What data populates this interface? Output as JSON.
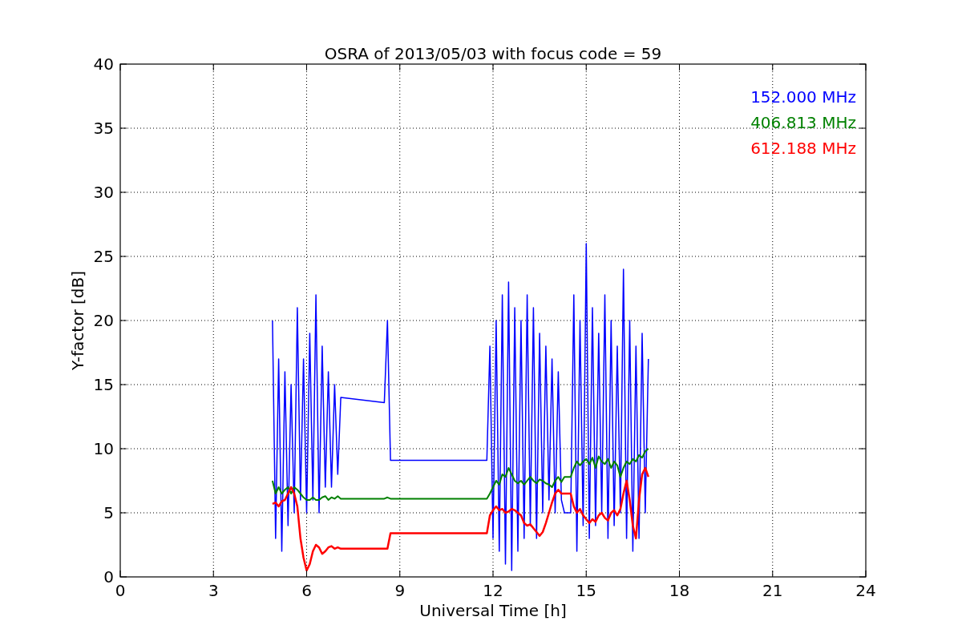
{
  "chart_data": {
    "type": "line",
    "title": "OSRA of 2013/05/03 with focus code = 59",
    "xlabel": "Universal Time [h]",
    "ylabel": "Y-factor [dB]",
    "x": [
      4.9,
      5.0,
      5.1,
      5.2,
      5.3,
      5.4,
      5.5,
      5.6,
      5.7,
      5.8,
      5.9,
      6.0,
      6.1,
      6.2,
      6.3,
      6.4,
      6.5,
      6.6,
      6.7,
      6.8,
      6.9,
      7.0,
      7.1,
      8.5,
      8.6,
      8.7,
      11.8,
      11.9,
      12.0,
      12.1,
      12.2,
      12.3,
      12.4,
      12.5,
      12.6,
      12.7,
      12.8,
      12.9,
      13.0,
      13.1,
      13.2,
      13.3,
      13.4,
      13.5,
      13.6,
      13.7,
      13.8,
      13.9,
      14.0,
      14.1,
      14.2,
      14.3,
      14.5,
      14.6,
      14.7,
      14.8,
      14.9,
      15.0,
      15.1,
      15.2,
      15.3,
      15.4,
      15.5,
      15.6,
      15.7,
      15.8,
      15.9,
      16.0,
      16.1,
      16.2,
      16.3,
      16.4,
      16.5,
      16.6,
      16.7,
      16.8,
      16.9,
      17.0
    ],
    "series": [
      {
        "name": "152.000 MHz",
        "color": "#0000ff",
        "values": [
          20,
          3,
          17,
          2,
          16,
          4,
          15,
          5,
          21,
          6,
          17,
          5,
          19,
          6,
          22,
          5,
          18,
          7,
          16,
          7,
          15,
          8,
          14,
          13.6,
          20,
          9.1,
          9.1,
          18,
          3,
          20,
          2,
          22,
          1,
          23,
          0.5,
          21,
          2,
          20,
          3,
          22,
          4,
          21,
          3,
          19,
          5,
          18,
          6,
          17,
          5,
          16,
          6,
          5,
          5,
          22,
          2,
          20,
          4,
          26,
          3,
          21,
          4,
          19,
          5,
          22,
          3,
          20,
          4,
          18,
          5,
          24,
          3,
          20,
          2,
          18,
          3,
          19,
          5,
          17
        ]
      },
      {
        "name": "406.813 MHz",
        "color": "#008000",
        "values": [
          7.5,
          6.5,
          7,
          6.5,
          6.8,
          7,
          6.5,
          7,
          6.8,
          6.5,
          6.2,
          6,
          6,
          6.2,
          6,
          6,
          6.2,
          6.3,
          6,
          6.2,
          6.1,
          6.3,
          6.1,
          6.1,
          6.2,
          6.1,
          6.1,
          6.5,
          7,
          7.5,
          7.2,
          8,
          7.8,
          8.5,
          8,
          7.5,
          7.3,
          7.5,
          7.2,
          7.5,
          7.8,
          7.5,
          7.3,
          7.6,
          7.5,
          7.3,
          7.2,
          7,
          7.5,
          7.8,
          7.4,
          7.8,
          7.8,
          8.5,
          9,
          8.7,
          9,
          9.2,
          8.8,
          9.3,
          8.5,
          9.4,
          9,
          8.8,
          9.2,
          8.5,
          9,
          8.7,
          7.8,
          8.5,
          9,
          8.8,
          9.2,
          9,
          9.5,
          9.3,
          9.8,
          10
        ]
      },
      {
        "name": "612.188 MHz",
        "color": "#ff0000",
        "values": [
          5.7,
          5.8,
          5.5,
          5.9,
          6,
          6.5,
          7,
          6.5,
          5.5,
          3,
          1.5,
          0.5,
          1,
          2,
          2.5,
          2.3,
          1.8,
          2,
          2.3,
          2.4,
          2.2,
          2.3,
          2.2,
          2.2,
          2.2,
          3.4,
          3.4,
          4.8,
          5.2,
          5.5,
          5.2,
          5.3,
          5,
          5.1,
          5.3,
          5.2,
          5,
          4.8,
          4.2,
          4,
          4.1,
          3.8,
          3.5,
          3.2,
          3.5,
          4.2,
          5,
          5.8,
          6.5,
          6.8,
          6.5,
          6.5,
          6.5,
          5.5,
          5,
          5.3,
          4.8,
          4.5,
          4.2,
          4.5,
          4.3,
          4.8,
          5,
          4.6,
          4.4,
          5,
          5.2,
          4.8,
          5.3,
          6.5,
          7.5,
          6,
          4,
          3,
          6,
          8,
          8.5,
          7.8
        ]
      }
    ],
    "xlim": [
      0,
      24
    ],
    "ylim": [
      0,
      40
    ],
    "xticks": [
      0,
      3,
      6,
      9,
      12,
      15,
      18,
      21,
      24
    ],
    "yticks": [
      0,
      5,
      10,
      15,
      20,
      25,
      30,
      35,
      40
    ],
    "grid": true
  }
}
